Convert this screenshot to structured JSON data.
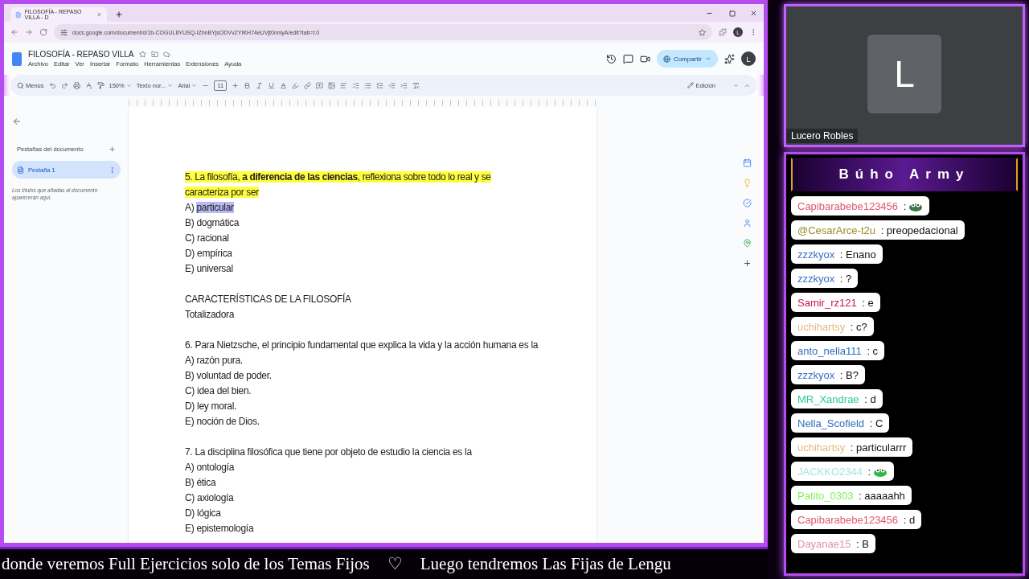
{
  "browser": {
    "tab_title": "FILOSOFÍA - REPASO VILLA - D",
    "url": "docs.google.com/document/d/1b-COGUL8YUSQ-IZhnBYjsODVvZYtKH74eUVjt0nniyA/edit?tab=t.0",
    "profile_initial": "L"
  },
  "docs": {
    "title": "FILOSOFÍA - REPASO VILLA",
    "menus": [
      "Archivo",
      "Editar",
      "Ver",
      "Insertar",
      "Formato",
      "Herramientas",
      "Extensiones",
      "Ayuda"
    ],
    "share_label": "Compartir",
    "account_initial": "L",
    "toolbar": {
      "search_label": "Menús",
      "zoom": "150%",
      "style": "Texto nor...",
      "font": "Arial",
      "font_size": "11",
      "mode": "Edición"
    }
  },
  "sidebar": {
    "heading": "Pestañas del documento",
    "tabs": [
      {
        "label": "Pestaña 1",
        "selected": true
      }
    ],
    "hint": "Los títulos que añadas al documento aparecerán aquí."
  },
  "document": {
    "paragraphs": [
      {
        "kind": "question-highlight",
        "text": "5. La filosofía, **a diferencia de las ciencias**, reflexiona sobre todo lo real y se caracteriza por ser"
      },
      {
        "kind": "option",
        "label": "A)",
        "text": "particular",
        "selected": true
      },
      {
        "kind": "option",
        "label": "B)",
        "text": "dogmática",
        "selected": false
      },
      {
        "kind": "option",
        "label": "C)",
        "text": "racional",
        "selected": false
      },
      {
        "kind": "option",
        "label": "D)",
        "text": "empírica",
        "selected": false
      },
      {
        "kind": "option",
        "label": "E)",
        "text": "universal",
        "selected": false
      },
      {
        "kind": "heading",
        "text": "CARACTERÍSTICAS DE LA FILOSOFÍA"
      },
      {
        "kind": "text",
        "text": "Totalizadora"
      },
      {
        "kind": "question",
        "text": "6. Para Nietzsche, el principio fundamental que explica la vida y la acción humana es la"
      },
      {
        "kind": "option",
        "label": "A)",
        "text": "razón pura.",
        "selected": false
      },
      {
        "kind": "option",
        "label": "B)",
        "text": "voluntad de poder.",
        "selected": false
      },
      {
        "kind": "option",
        "label": "C)",
        "text": "idea del bien.",
        "selected": false
      },
      {
        "kind": "option",
        "label": "D)",
        "text": "ley moral.",
        "selected": false
      },
      {
        "kind": "option",
        "label": "E)",
        "text": "noción de Dios.",
        "selected": false
      },
      {
        "kind": "question",
        "text": "7. La disciplina filosófica que tiene por objeto de estudio la ciencia es la"
      },
      {
        "kind": "option",
        "label": "A)",
        "text": "ontología",
        "selected": false
      },
      {
        "kind": "option",
        "label": "B)",
        "text": "ética",
        "selected": false
      },
      {
        "kind": "option",
        "label": "C)",
        "text": "axiología",
        "selected": false
      },
      {
        "kind": "option",
        "label": "D)",
        "text": "lógica",
        "selected": false
      },
      {
        "kind": "option",
        "label": "E)",
        "text": "epistemología",
        "selected": false
      }
    ]
  },
  "webcam": {
    "initial": "L",
    "name": "Lucero Robles"
  },
  "chat": {
    "title": "Búho Army",
    "messages": [
      {
        "kind": "emote",
        "user": "Capibarabebe123456",
        "color": "#e0566f",
        "text": ":"
      },
      {
        "kind": "text",
        "user": "@CesarArce-t2u",
        "color": "#9a8a2a",
        "text": ": preopedacional"
      },
      {
        "kind": "text",
        "user": "zzzkyox",
        "color": "#3a6fc4",
        "text": ": Enano"
      },
      {
        "kind": "text",
        "user": "zzzkyox",
        "color": "#3a6fc4",
        "text": ": ?"
      },
      {
        "kind": "text",
        "user": "Samir_rz121",
        "color": "#c8174a",
        "text": ": e"
      },
      {
        "kind": "text",
        "user": "uchihartsy",
        "color": "#e8b87a",
        "text": ": c?"
      },
      {
        "kind": "text",
        "user": "anto_nella111",
        "color": "#2e6fc0",
        "text": ": c"
      },
      {
        "kind": "text",
        "user": "zzzkyox",
        "color": "#3a6fc4",
        "text": ": B?"
      },
      {
        "kind": "text",
        "user": "MR_Xandrae",
        "color": "#2ec9a0",
        "text": ": d"
      },
      {
        "kind": "text",
        "user": "Nella_Scofield",
        "color": "#2e6fc0",
        "text": ": C"
      },
      {
        "kind": "text",
        "user": "uchihartsy",
        "color": "#e8b87a",
        "text": ": particularrr"
      },
      {
        "kind": "emote",
        "user": "JACKKO2344",
        "color": "#a8e4dc",
        "text": ":"
      },
      {
        "kind": "text",
        "user": "Patito_0303",
        "color": "#7ef05a",
        "text": ": aaaaahh"
      },
      {
        "kind": "text",
        "user": "Capibarabebe123456",
        "color": "#e0566f",
        "text": ": d"
      },
      {
        "kind": "text",
        "user": "Dayanae15",
        "color": "#e090b0",
        "text": ": B"
      }
    ]
  },
  "ticker": [
    "donde veremos Full Ejercicios solo de los Temas Fijos",
    "♡",
    "Luego tendremos Las Fijas de Lengu"
  ]
}
